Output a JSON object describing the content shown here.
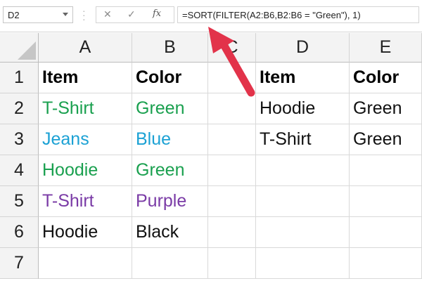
{
  "formula_bar": {
    "name_box": "D2",
    "cancel_icon": "✕",
    "enter_icon": "✓",
    "fx_label": "fx",
    "formula": "=SORT(FILTER(A2:B6,B2:B6 = \"Green\"), 1)"
  },
  "columns": [
    "A",
    "B",
    "C",
    "D",
    "E"
  ],
  "rows": [
    "1",
    "2",
    "3",
    "4",
    "5",
    "6",
    "7"
  ],
  "cells": {
    "A1": "Item",
    "B1": "Color",
    "D1": "Item",
    "E1": "Color",
    "A2": "T-Shirt",
    "B2": "Green",
    "D2": "Hoodie",
    "E2": "Green",
    "A3": "Jeans",
    "B3": "Blue",
    "D3": "T-Shirt",
    "E3": "Green",
    "A4": "Hoodie",
    "B4": "Green",
    "A5": "T-Shirt",
    "B5": "Purple",
    "A6": "Hoodie",
    "B6": "Black"
  },
  "colors": {
    "green": "#1aa04f",
    "blue": "#1ba1d4",
    "purple": "#7a3ba6",
    "black": "#111111",
    "arrow": "#e2334a"
  }
}
